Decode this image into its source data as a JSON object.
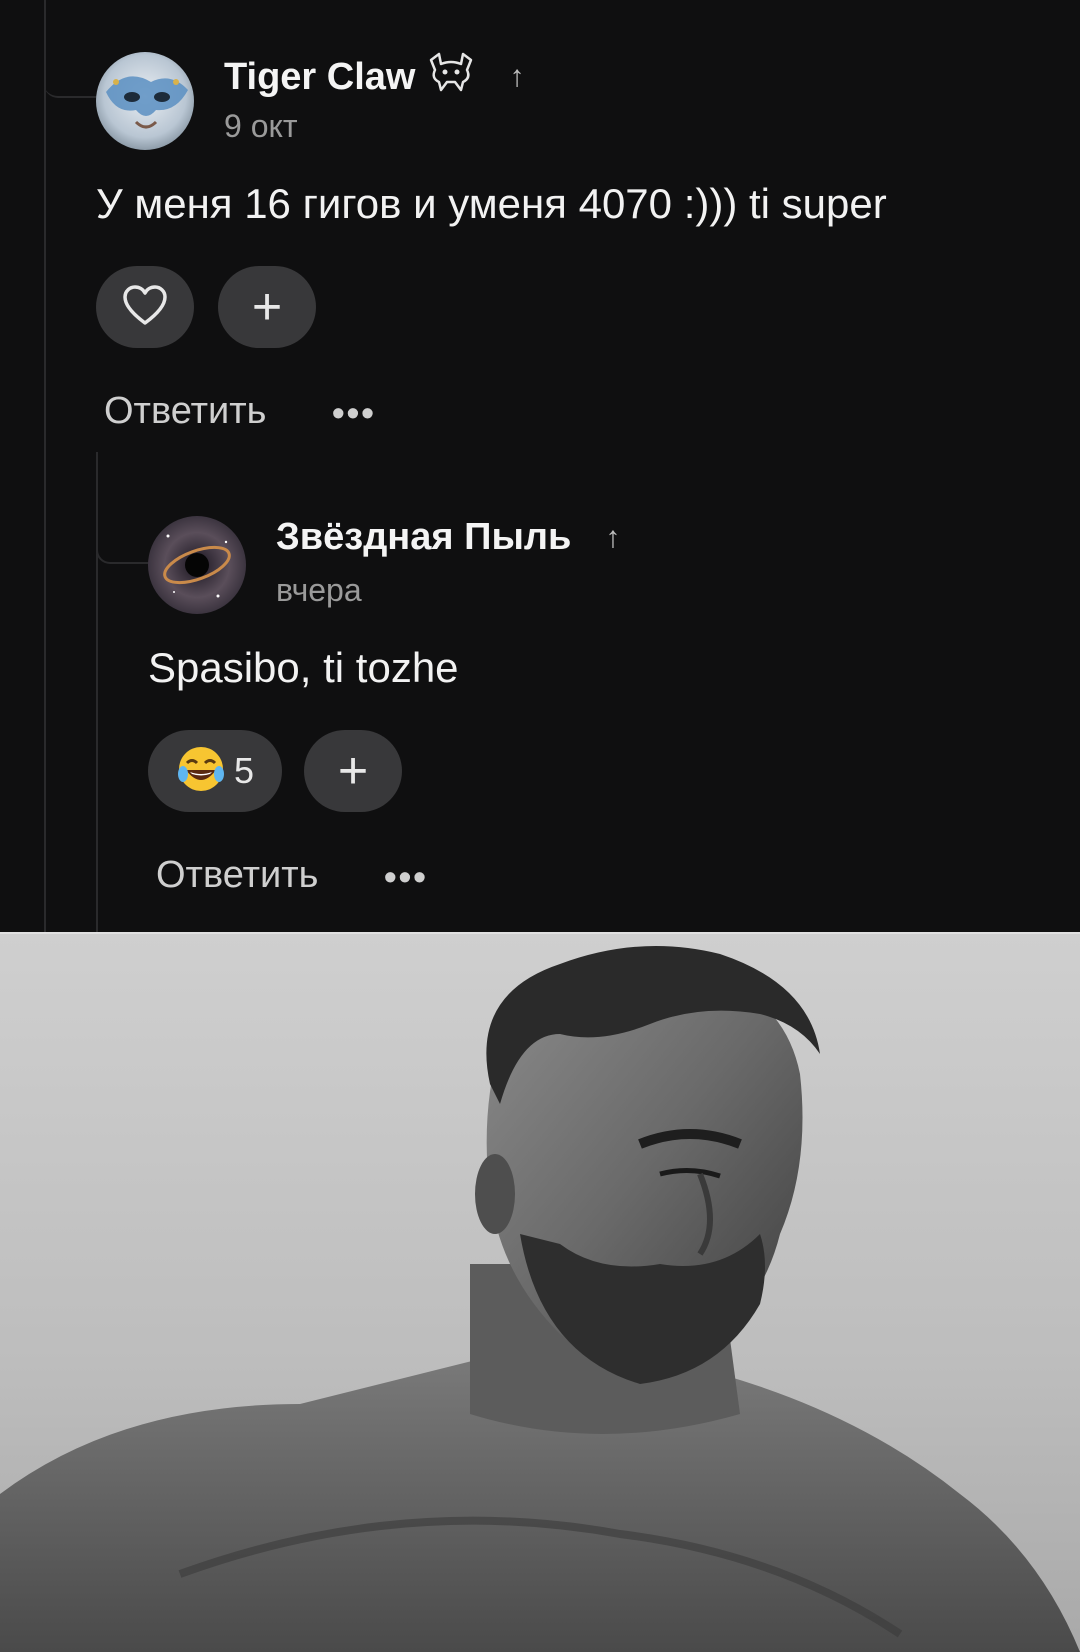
{
  "comments": [
    {
      "author": "Tiger Claw",
      "date": "9 окт",
      "text": "У меня 16 гигов и уменя 4070 :))) ti super",
      "reply_label": "Ответить",
      "more_label": "•••"
    },
    {
      "author": "Звёздная Пыль",
      "date": "вчера",
      "text": "Spasibo, ti tozhe",
      "reaction_count": "5",
      "reply_label": "Ответить",
      "more_label": "•••"
    }
  ],
  "icons": {
    "upvote": "↑",
    "plus": "+",
    "like": "heart-icon",
    "laugh_emoji": "😂",
    "badge": "cat-badge-icon"
  },
  "colors": {
    "background": "#0f0f10",
    "pill": "#38383a",
    "muted_text": "#9a9a9a"
  }
}
